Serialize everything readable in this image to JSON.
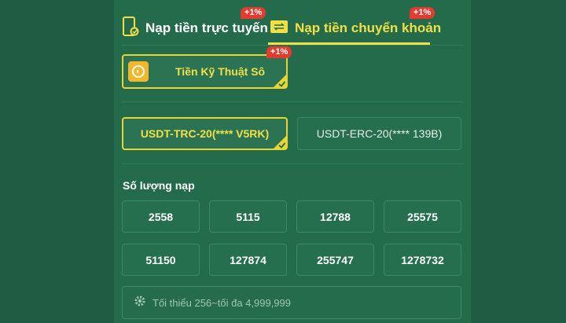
{
  "tabs": [
    {
      "label": "Nạp tiền trực tuyến",
      "badge": "+1%",
      "icon": "phone-icon"
    },
    {
      "label": "Nạp tiền chuyển khoản",
      "badge": "+1%",
      "icon": "wallet-icon",
      "active": true
    }
  ],
  "method": {
    "label": "Tiền Kỹ Thuật Sô",
    "badge": "+1%",
    "icon": "coin-icon"
  },
  "networks": [
    {
      "label": "USDT-TRC-20(**** V5RK)",
      "selected": true
    },
    {
      "label": "USDT-ERC-20(**** 139B)",
      "selected": false
    }
  ],
  "amount": {
    "title": "Số lượng nạp",
    "options": [
      "2558",
      "5115",
      "12788",
      "25575",
      "51150",
      "127874",
      "255747",
      "1278732"
    ]
  },
  "limit": {
    "text": "Tối thiểu 256~tối đa 4,999,999",
    "icon": "gear-icon"
  },
  "colors": {
    "accent": "#f0e046",
    "badge": "#e23b2f",
    "panel": "#236b4b",
    "background": "#1f5c43"
  }
}
